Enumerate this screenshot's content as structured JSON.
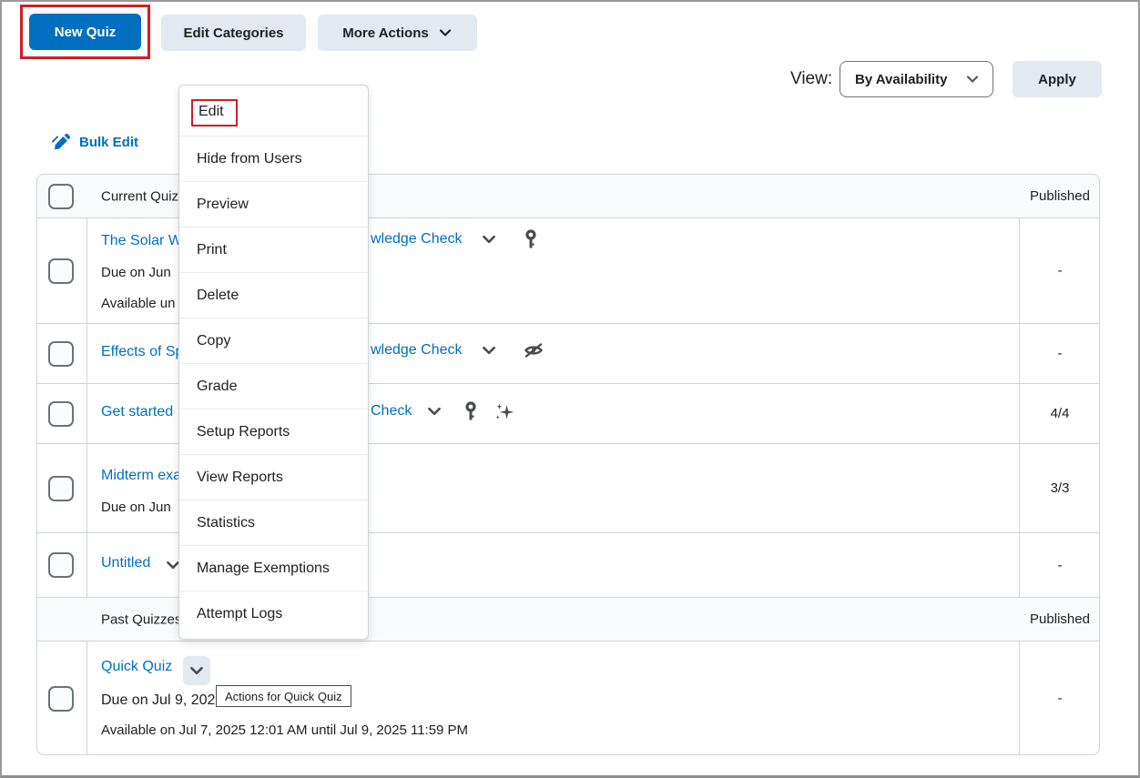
{
  "toolbar": {
    "new_quiz": "New Quiz",
    "edit_categories": "Edit Categories",
    "more_actions": "More Actions"
  },
  "view_bar": {
    "label": "View:",
    "selected_option": "By Availability",
    "apply": "Apply"
  },
  "bulk_edit_label": "Bulk Edit",
  "context_menu": {
    "items": [
      "Edit",
      "Hide from Users",
      "Preview",
      "Print",
      "Delete",
      "Copy",
      "Grade",
      "Setup Reports",
      "View Reports",
      "Statistics",
      "Manage Exemptions",
      "Attempt Logs"
    ]
  },
  "table": {
    "current_header": {
      "category": "Current Quizz",
      "published": "Published"
    },
    "past_header": {
      "category": "Past Quizzes",
      "published": "Published"
    },
    "rows": [
      {
        "title_left": "The Solar W",
        "title_right": "wledge Check",
        "line2": "Due on Jun",
        "line3": "Available un",
        "published": "-"
      },
      {
        "title_left": "Effects of Sp",
        "title_right": "wledge Check",
        "published": "-"
      },
      {
        "title_left": "Get started",
        "title_right": "Check",
        "published": "4/4"
      },
      {
        "title_left": "Midterm exa",
        "line2": "Due on Jun",
        "published": "3/3"
      },
      {
        "title_left": "Untitled",
        "published": "-"
      },
      {
        "title": "Quick Quiz",
        "line2": "Due on Jul 9, 202",
        "line3": "Available on Jul 7, 2025 12:01 AM until Jul 9, 2025 11:59 PM",
        "published": "-"
      }
    ]
  },
  "tooltip": "Actions for Quick Quiz",
  "colors": {
    "accent_blue": "#006fbf",
    "highlight_red": "#cb2026",
    "secondary_button_bg": "#e3e9f1",
    "table_border": "#cdd5dc",
    "section_row_bg": "#f9fafb",
    "icon_gray": "#494c4e"
  }
}
